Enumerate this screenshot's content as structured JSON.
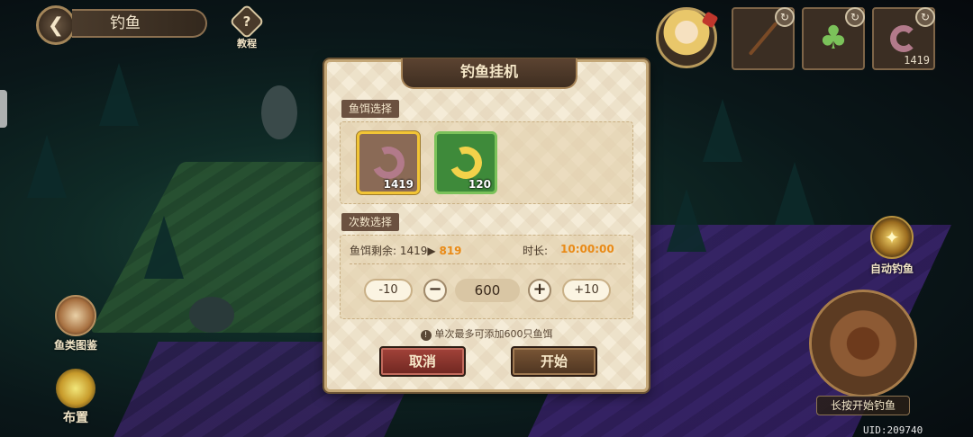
{
  "header": {
    "back_icon": "back-arrow-icon",
    "title": "钓鱼",
    "tutorial_label": "教程",
    "tutorial_glyph": "?"
  },
  "top_right": {
    "slots": [
      {
        "name": "fishing-rod",
        "count": ""
      },
      {
        "name": "clover",
        "count": ""
      },
      {
        "name": "worm-bait",
        "count": "1419"
      }
    ]
  },
  "side": {
    "auto_fish": "自动钓鱼",
    "fish_book": "鱼类图鉴",
    "arrange": "布置",
    "reel_label": "长按开始钓鱼",
    "uid": "UID:209740"
  },
  "modal": {
    "title": "钓鱼挂机",
    "bait_section": "鱼饵选择",
    "baits": [
      {
        "kind": "worm",
        "count": "1419",
        "selected": true
      },
      {
        "kind": "golden-worm",
        "count": "120",
        "selected": false
      }
    ],
    "count_section": "次数选择",
    "remain_label": "鱼饵剩余:",
    "remain_from": "1419",
    "remain_arrow": "▶",
    "remain_to": "819",
    "duration_label": "时长:",
    "duration_value": "10:00:00",
    "minus10": "-10",
    "minus": "−",
    "quantity": "600",
    "plus": "+",
    "plus10": "+10",
    "hint": "单次最多可添加600只鱼饵",
    "cancel": "取消",
    "start": "开始"
  },
  "colors": {
    "accent_orange": "#e98a16",
    "selected_border": "#f2c536",
    "cancel_red": "#a3433a"
  }
}
